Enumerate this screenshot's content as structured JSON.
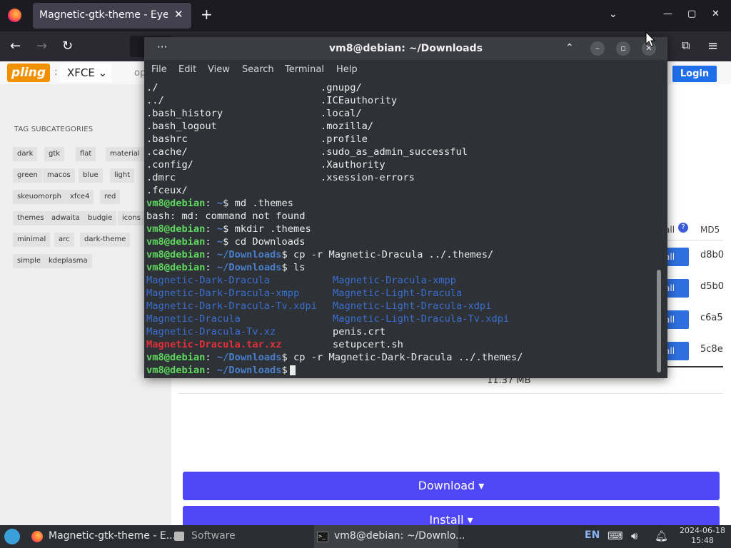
{
  "browser": {
    "tab_title": "Magnetic-gtk-theme - Eyecandy",
    "tab_close": "✕",
    "new_tab": "+",
    "tab_list": "⌄",
    "win_min": "—",
    "win_max": "▢",
    "win_close": "✕",
    "back": "←",
    "forward": "→",
    "reload": "↻",
    "extensions": "⧉",
    "menu": "≡"
  },
  "site": {
    "logo": "pling",
    "logo_sep": ":",
    "category": "XFCE ⌄",
    "op_text": "op",
    "login": "Login",
    "tag_title": "TAG SUBCATEGORIES",
    "tags": [
      "dark",
      "gtk",
      "flat",
      "material",
      "green",
      "macos",
      "blue",
      "light",
      "skeuomorph",
      "xfce4",
      "red",
      "themes",
      "adwaita",
      "budgie",
      "icons",
      "minimal",
      "arc",
      "dark-theme",
      "simple",
      "kdeplasma"
    ],
    "col_install": "all",
    "col_md5": "MD5",
    "install_label": "all",
    "md5_rows": [
      "d8b0",
      "d5b0",
      "c6a5",
      "5c8e"
    ],
    "file_size": "11.37 MB",
    "download_btn": "Download ▾",
    "install_btn": "Install ▾"
  },
  "terminal": {
    "title": "vm8@debian: ~/Downloads",
    "title_dots": "···",
    "btn_up": "⌃",
    "btn_min": "–",
    "btn_max": "▫",
    "btn_close": "✕",
    "menu": [
      "File",
      "Edit",
      "View",
      "Search",
      "Terminal",
      "Help"
    ],
    "listing": [
      [
        "./",
        ".gnupg/"
      ],
      [
        "../",
        ".ICEauthority"
      ],
      [
        ".bash_history",
        ".local/"
      ],
      [
        ".bash_logout",
        ".mozilla/"
      ],
      [
        ".bashrc",
        ".profile"
      ],
      [
        ".cache/",
        ".sudo_as_admin_successful"
      ],
      [
        ".config/",
        ".Xauthority"
      ],
      [
        ".dmrc",
        ".xsession-errors"
      ],
      [
        ".fceux/",
        ""
      ]
    ],
    "prompt_user": "vm8@debian",
    "prompt_colon": ":",
    "home": " ~",
    "downloads": " ~/Downloads",
    "cmd1": "$ md .themes",
    "err1": "bash: md: command not found",
    "cmd2": "$ mkdir .themes",
    "cmd3": "$ cd Downloads",
    "cmd4": "$ cp -r Magnetic-Dracula ../.themes/",
    "cmd5": "$ ls",
    "ls": [
      [
        "Magnetic-Dark-Dracula",
        "Magnetic-Dracula-xmpp"
      ],
      [
        "Magnetic-Dark-Dracula-xmpp",
        "Magnetic-Light-Dracula"
      ],
      [
        "Magnetic-Dark-Dracula-Tv.xdpi",
        "Magnetic-Light-Dracula-xdpi"
      ],
      [
        "Magnetic-Dracula",
        "Magnetic-Light-Dracula-Tv.xdpi"
      ],
      [
        "Magnetic-Dracula-Tv.xz",
        "penis.crt"
      ],
      [
        "Magnetic-Dracula.tar.xz",
        "setupcert.sh"
      ]
    ],
    "cmd6": "$ cp -r Magnetic-Dark-Dracula ../.themes/",
    "cmd7": "$"
  },
  "taskbar": {
    "firefox_task": "Magnetic-gtk-theme - E...",
    "software_task": "Software",
    "terminal_task": "vm8@debian: ~/Downlo...",
    "lang": "EN",
    "date": "2024-06-18",
    "time": "15:48"
  }
}
